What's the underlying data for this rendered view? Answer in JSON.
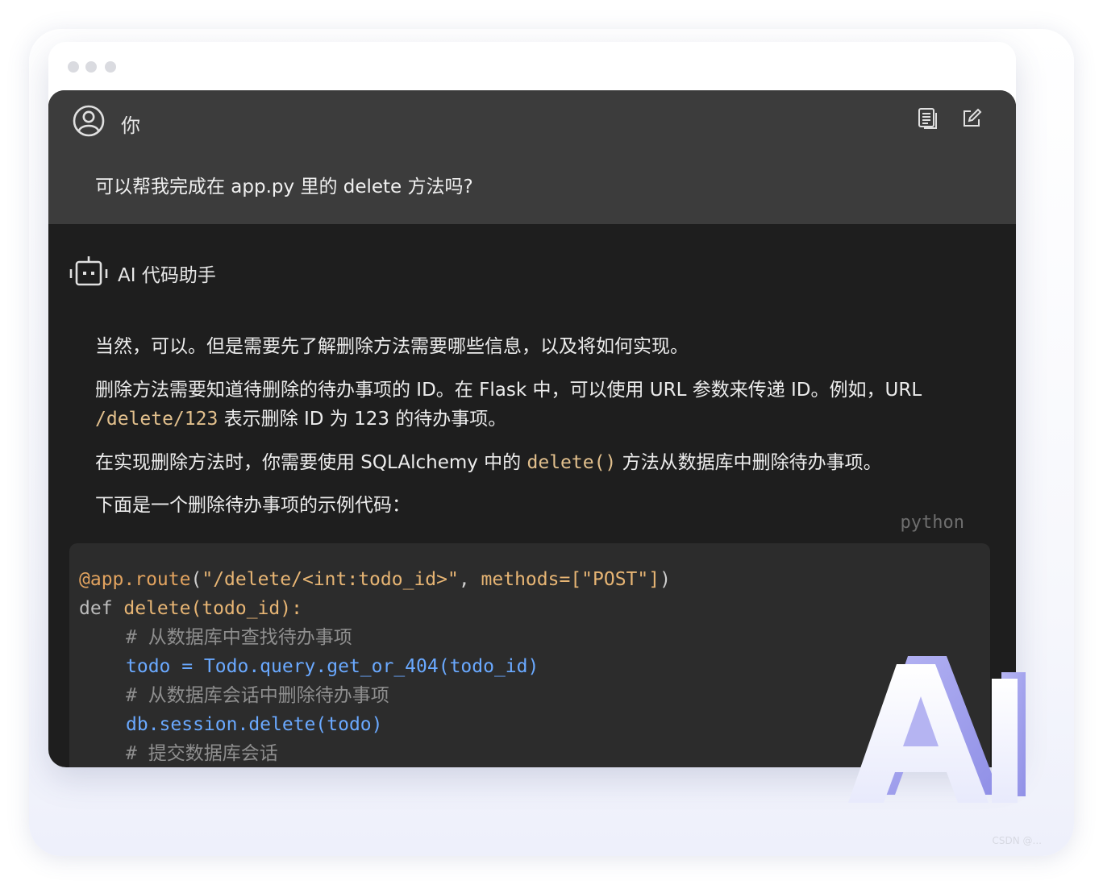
{
  "user": {
    "name": "你",
    "message": "可以帮我完成在 app.py 里的 delete 方法吗?"
  },
  "assistant": {
    "name": "AI 代码助手",
    "paragraphs": {
      "p1": "当然，可以。但是需要先了解删除方法需要哪些信息，以及将如何实现。",
      "p2_part1": "删除方法需要知道待删除的待办事项的 ID。在 Flask 中，可以使用 URL 参数来传递 ID。例如，URL",
      "p2_code": "/delete/123",
      "p2_part2": " 表示删除 ID 为 123 的待办事项。",
      "p3_part1": "在实现删除方法时，你需要使用 SQLAlchemy 中的 ",
      "p3_code": "delete()",
      "p3_part2": " 方法从数据库中删除待办事项。",
      "p4": "下面是一个删除待办事项的示例代码："
    },
    "code": {
      "language": "python",
      "line1_decorator": "@app.route",
      "line1_open": "(",
      "line1_path": "\"/delete/<int:todo_id>\"",
      "line1_comma": ", ",
      "line1_methods": "methods=[\"POST\"]",
      "line1_close": ")",
      "line2_def": "def ",
      "line2_name": "delete(todo_id):",
      "line3_comment": "# 从数据库中查找待办事项",
      "line4_code": "todo = Todo.query.get_or_404(todo_id)",
      "line5_comment": "# 从数据库会话中删除待办事项",
      "line6_code": "db.session.delete(todo)",
      "line7_comment": "# 提交数据库会话"
    }
  },
  "badge": {
    "text": "AI"
  },
  "watermark": "CSDN @..."
}
